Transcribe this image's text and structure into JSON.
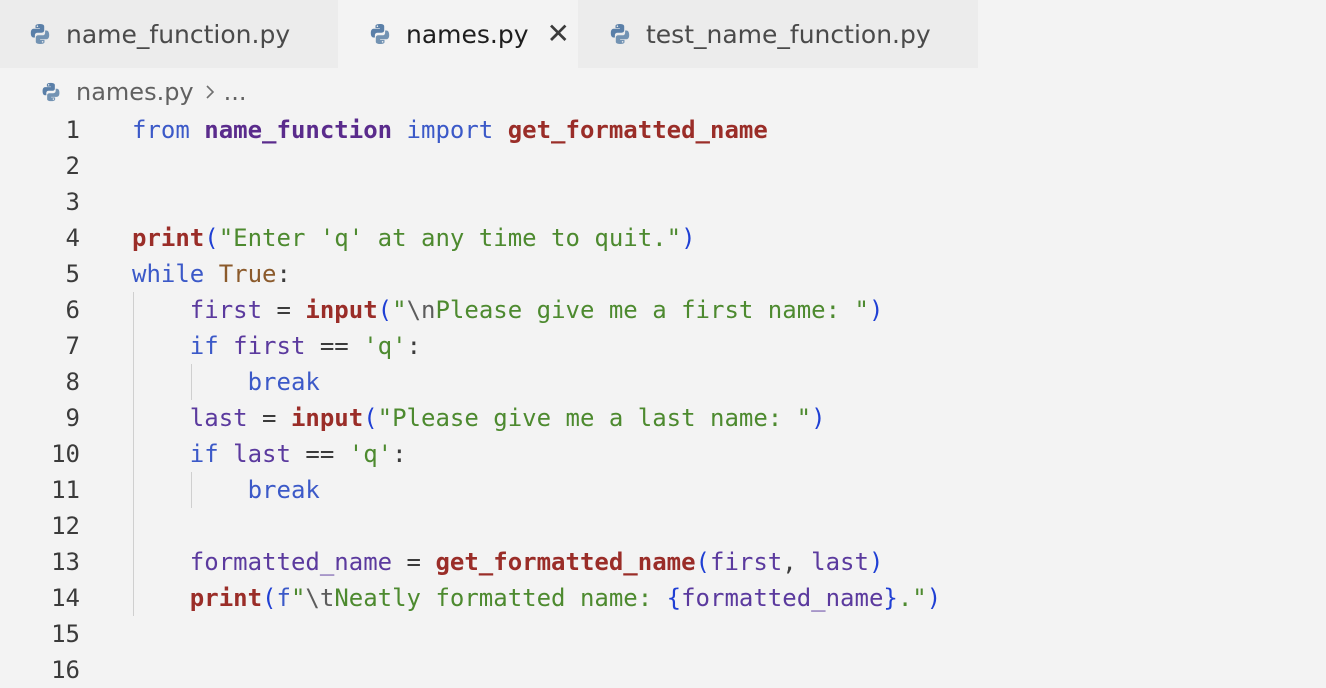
{
  "tabs": [
    {
      "label": "name_function.py",
      "active": false,
      "icon": "python-icon"
    },
    {
      "label": "names.py",
      "active": true,
      "icon": "python-icon",
      "close": "✕"
    },
    {
      "label": "test_name_function.py",
      "active": false,
      "icon": "python-icon"
    }
  ],
  "breadcrumb": {
    "file": "names.py",
    "more": "..."
  },
  "colors": {
    "keyword": "#3b59c8",
    "function": "#9a2d28",
    "string": "#4d8a2f",
    "variable": "#5b3a9e",
    "background": "#f3f3f3"
  },
  "editor": {
    "line_numbers": [
      "1",
      "2",
      "3",
      "4",
      "5",
      "6",
      "7",
      "8",
      "9",
      "10",
      "11",
      "12",
      "13",
      "14",
      "15",
      "16"
    ],
    "lines": [
      [
        {
          "t": "from",
          "c": "kw"
        },
        {
          "t": " ",
          "c": "punc"
        },
        {
          "t": "name_function",
          "c": "mod"
        },
        {
          "t": " ",
          "c": "punc"
        },
        {
          "t": "import",
          "c": "kw"
        },
        {
          "t": " ",
          "c": "punc"
        },
        {
          "t": "get_formatted_name",
          "c": "fn"
        }
      ],
      [],
      [],
      [
        {
          "t": "print",
          "c": "fn"
        },
        {
          "t": "(",
          "c": "paren"
        },
        {
          "t": "\"Enter 'q' at any time to quit.\"",
          "c": "str"
        },
        {
          "t": ")",
          "c": "paren"
        }
      ],
      [
        {
          "t": "while",
          "c": "kw"
        },
        {
          "t": " ",
          "c": "punc"
        },
        {
          "t": "True",
          "c": "bool"
        },
        {
          "t": ":",
          "c": "punc"
        }
      ],
      [
        {
          "t": "    ",
          "c": "punc"
        },
        {
          "t": "first",
          "c": "var"
        },
        {
          "t": " = ",
          "c": "punc"
        },
        {
          "t": "input",
          "c": "fn"
        },
        {
          "t": "(",
          "c": "paren"
        },
        {
          "t": "\"",
          "c": "str"
        },
        {
          "t": "\\n",
          "c": "esc"
        },
        {
          "t": "Please give me a first name: \"",
          "c": "str"
        },
        {
          "t": ")",
          "c": "paren"
        }
      ],
      [
        {
          "t": "    ",
          "c": "punc"
        },
        {
          "t": "if",
          "c": "kw"
        },
        {
          "t": " ",
          "c": "punc"
        },
        {
          "t": "first",
          "c": "var"
        },
        {
          "t": " == ",
          "c": "punc"
        },
        {
          "t": "'q'",
          "c": "str"
        },
        {
          "t": ":",
          "c": "punc"
        }
      ],
      [
        {
          "t": "        ",
          "c": "punc"
        },
        {
          "t": "break",
          "c": "kw"
        }
      ],
      [
        {
          "t": "    ",
          "c": "punc"
        },
        {
          "t": "last",
          "c": "var"
        },
        {
          "t": " = ",
          "c": "punc"
        },
        {
          "t": "input",
          "c": "fn"
        },
        {
          "t": "(",
          "c": "paren"
        },
        {
          "t": "\"Please give me a last name: \"",
          "c": "str"
        },
        {
          "t": ")",
          "c": "paren"
        }
      ],
      [
        {
          "t": "    ",
          "c": "punc"
        },
        {
          "t": "if",
          "c": "kw"
        },
        {
          "t": " ",
          "c": "punc"
        },
        {
          "t": "last",
          "c": "var"
        },
        {
          "t": " == ",
          "c": "punc"
        },
        {
          "t": "'q'",
          "c": "str"
        },
        {
          "t": ":",
          "c": "punc"
        }
      ],
      [
        {
          "t": "        ",
          "c": "punc"
        },
        {
          "t": "break",
          "c": "kw"
        }
      ],
      [],
      [
        {
          "t": "    ",
          "c": "punc"
        },
        {
          "t": "formatted_name",
          "c": "var"
        },
        {
          "t": " = ",
          "c": "punc"
        },
        {
          "t": "get_formatted_name",
          "c": "fn"
        },
        {
          "t": "(",
          "c": "paren"
        },
        {
          "t": "first",
          "c": "var"
        },
        {
          "t": ", ",
          "c": "punc"
        },
        {
          "t": "last",
          "c": "var"
        },
        {
          "t": ")",
          "c": "paren"
        }
      ],
      [
        {
          "t": "    ",
          "c": "punc"
        },
        {
          "t": "print",
          "c": "fn"
        },
        {
          "t": "(",
          "c": "paren"
        },
        {
          "t": "f",
          "c": "kw"
        },
        {
          "t": "\"",
          "c": "str"
        },
        {
          "t": "\\t",
          "c": "esc"
        },
        {
          "t": "Neatly formatted name: ",
          "c": "str"
        },
        {
          "t": "{",
          "c": "paren"
        },
        {
          "t": "formatted_name",
          "c": "var"
        },
        {
          "t": "}",
          "c": "paren"
        },
        {
          "t": ".\"",
          "c": "str"
        },
        {
          "t": ")",
          "c": "paren"
        }
      ],
      [],
      []
    ]
  }
}
